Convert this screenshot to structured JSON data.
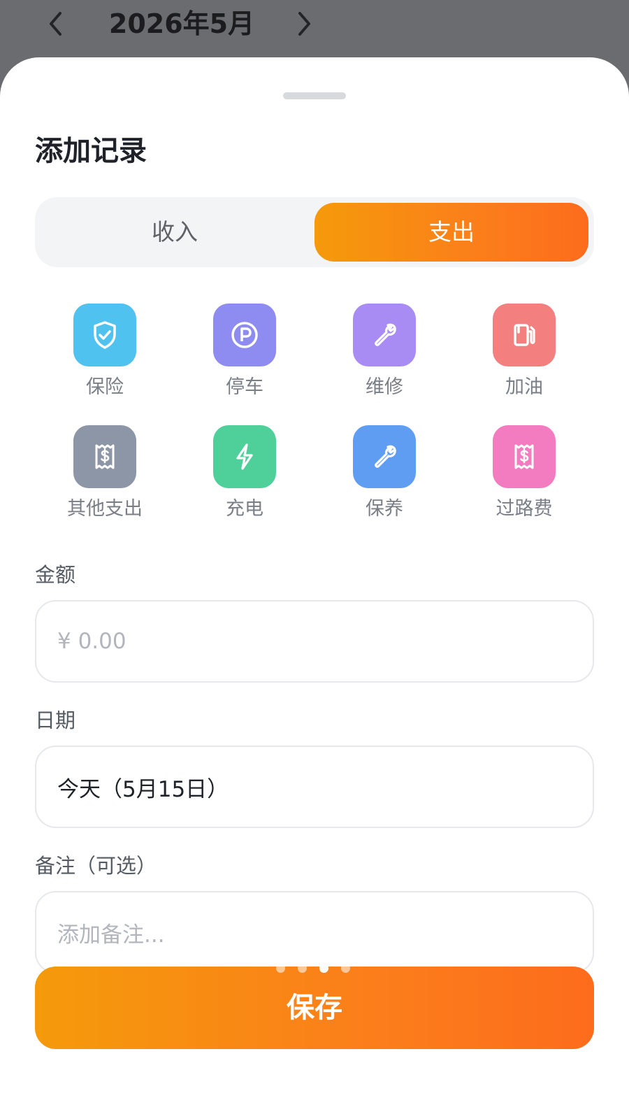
{
  "header": {
    "month": "2026年5月"
  },
  "sheet": {
    "title": "添加记录",
    "type_toggle": {
      "income": "收入",
      "expense": "支出",
      "selected": "expense"
    },
    "categories": [
      {
        "label": "保险",
        "icon": "shield-check-icon",
        "color": "#4fc2ef"
      },
      {
        "label": "停车",
        "icon": "parking-icon",
        "color": "#8e8cf0"
      },
      {
        "label": "维修",
        "icon": "wrench-icon",
        "color": "#a98cf3"
      },
      {
        "label": "加油",
        "icon": "fuel-pump-icon",
        "color": "#f47f7f"
      },
      {
        "label": "其他支出",
        "icon": "receipt-dollar-icon",
        "color": "#8d96a6"
      },
      {
        "label": "充电",
        "icon": "lightning-icon",
        "color": "#4fcf99"
      },
      {
        "label": "保养",
        "icon": "wrench-icon",
        "color": "#5f9df3"
      },
      {
        "label": "过路费",
        "icon": "receipt-dollar-icon",
        "color": "#f37cc1"
      }
    ],
    "amount": {
      "label": "金额",
      "placeholder": "¥ 0.00",
      "value": ""
    },
    "date": {
      "label": "日期",
      "value": "今天（5月15日）"
    },
    "note": {
      "label": "备注（可选）",
      "placeholder": "添加备注...",
      "value": ""
    },
    "save_label": "保存",
    "page_dots": {
      "count": 4,
      "active_index": 2
    }
  },
  "colors": {
    "accent_start": "#f59a0b",
    "accent_end": "#fd6c1c",
    "backdrop": "#6b6c6f"
  }
}
